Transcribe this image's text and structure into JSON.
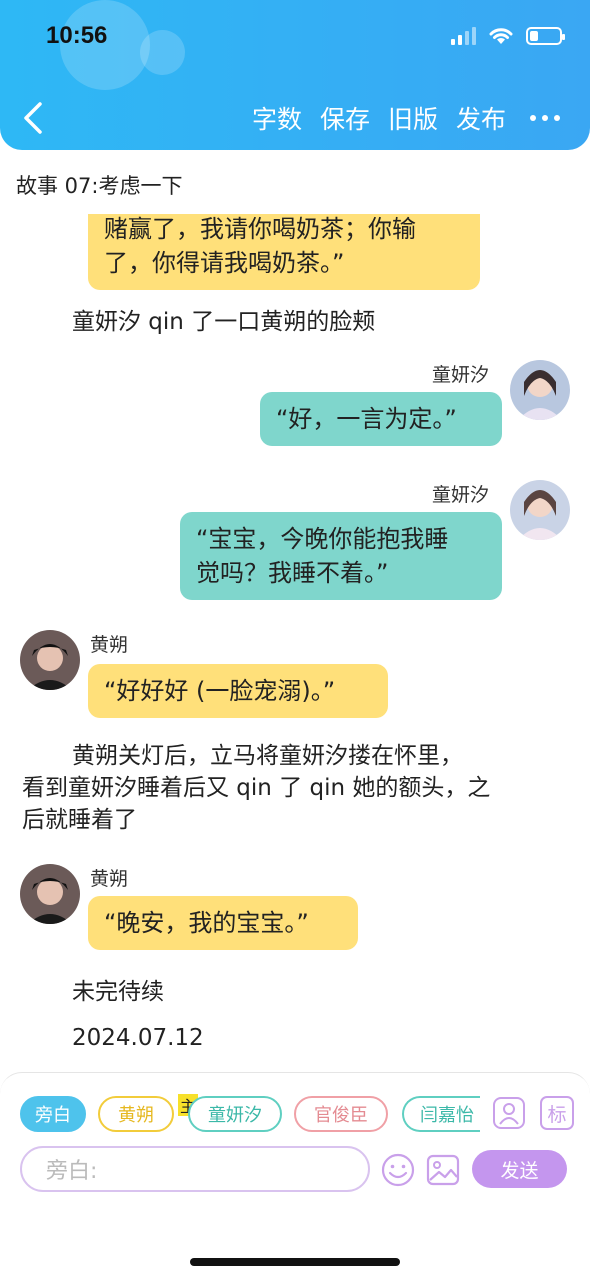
{
  "status_bar": {
    "time": "10:56"
  },
  "header": {
    "actions": [
      "字数",
      "保存",
      "旧版",
      "发布"
    ]
  },
  "story": {
    "title": "故事 07:考虑一下"
  },
  "messages": {
    "m0": {
      "line1": "赌赢了，我请你喝奶茶；你输",
      "line2": "了，你得请我喝奶茶。”"
    },
    "n1": "童妍汐 qin 了一口黄朔的脸颊",
    "m2": {
      "speaker": "童妍汐",
      "text": "“好，一言为定。”"
    },
    "m3": {
      "speaker": "童妍汐",
      "line1": "“宝宝，今晚你能抱我睡",
      "line2": "觉吗？我睡不着。”"
    },
    "m4": {
      "speaker": "黄朔",
      "text": "“好好好 (一脸宠溺)。”"
    },
    "n5": {
      "line1": "黄朔关灯后，立马将童妍汐搂在怀里，",
      "line2": "看到童妍汐睡着后又 qin 了 qin 她的额头，之",
      "line3": "后就睡着了"
    },
    "m6": {
      "speaker": "黄朔",
      "text": "“晚安，我的宝宝。”"
    },
    "n7": "未完待续",
    "n8": "2024.07.12"
  },
  "roles": [
    {
      "label": "旁白",
      "color": "#4ec3ec"
    },
    {
      "label": "黄朔",
      "color": "#f2cc3b"
    },
    {
      "label": "童妍汐",
      "color": "#5fcfc1",
      "badge": "主"
    },
    {
      "label": "官俊臣",
      "color": "#f0a0a6"
    },
    {
      "label": "闫嘉怡",
      "color": "#5fcfc1"
    }
  ],
  "composer": {
    "placeholder": "旁白:",
    "send_label": "发送",
    "mark_label": "标"
  }
}
